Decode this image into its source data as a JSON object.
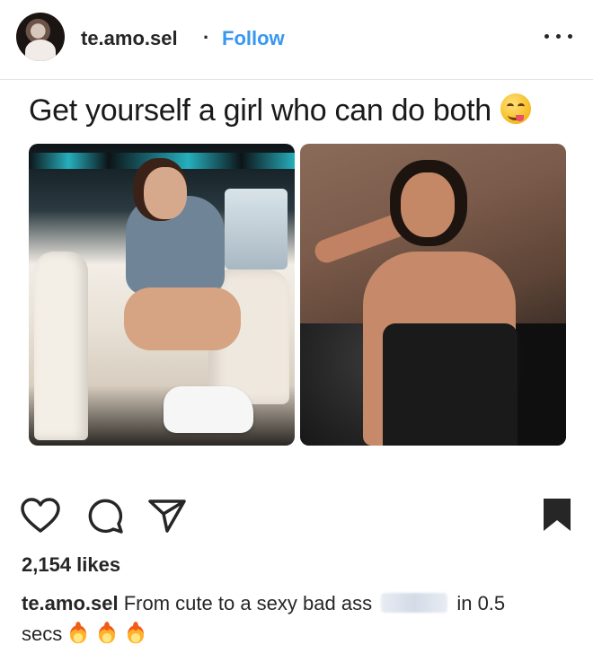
{
  "post": {
    "username": "te.amo.sel",
    "separator": "·",
    "follow_label": "Follow",
    "meme_caption": "Get yourself a girl who can do both",
    "likes": "2,154 likes",
    "caption_user": "te.amo.sel",
    "caption_text_1": "From cute to a sexy bad ass",
    "caption_text_2": "in 0.5",
    "caption_text_3": "secs"
  },
  "icons": {
    "more": "more-options-icon",
    "like": "heart-icon",
    "comment": "comment-icon",
    "share": "share-icon",
    "save": "bookmark-icon"
  },
  "colors": {
    "accent": "#3897f0",
    "text": "#262626"
  }
}
